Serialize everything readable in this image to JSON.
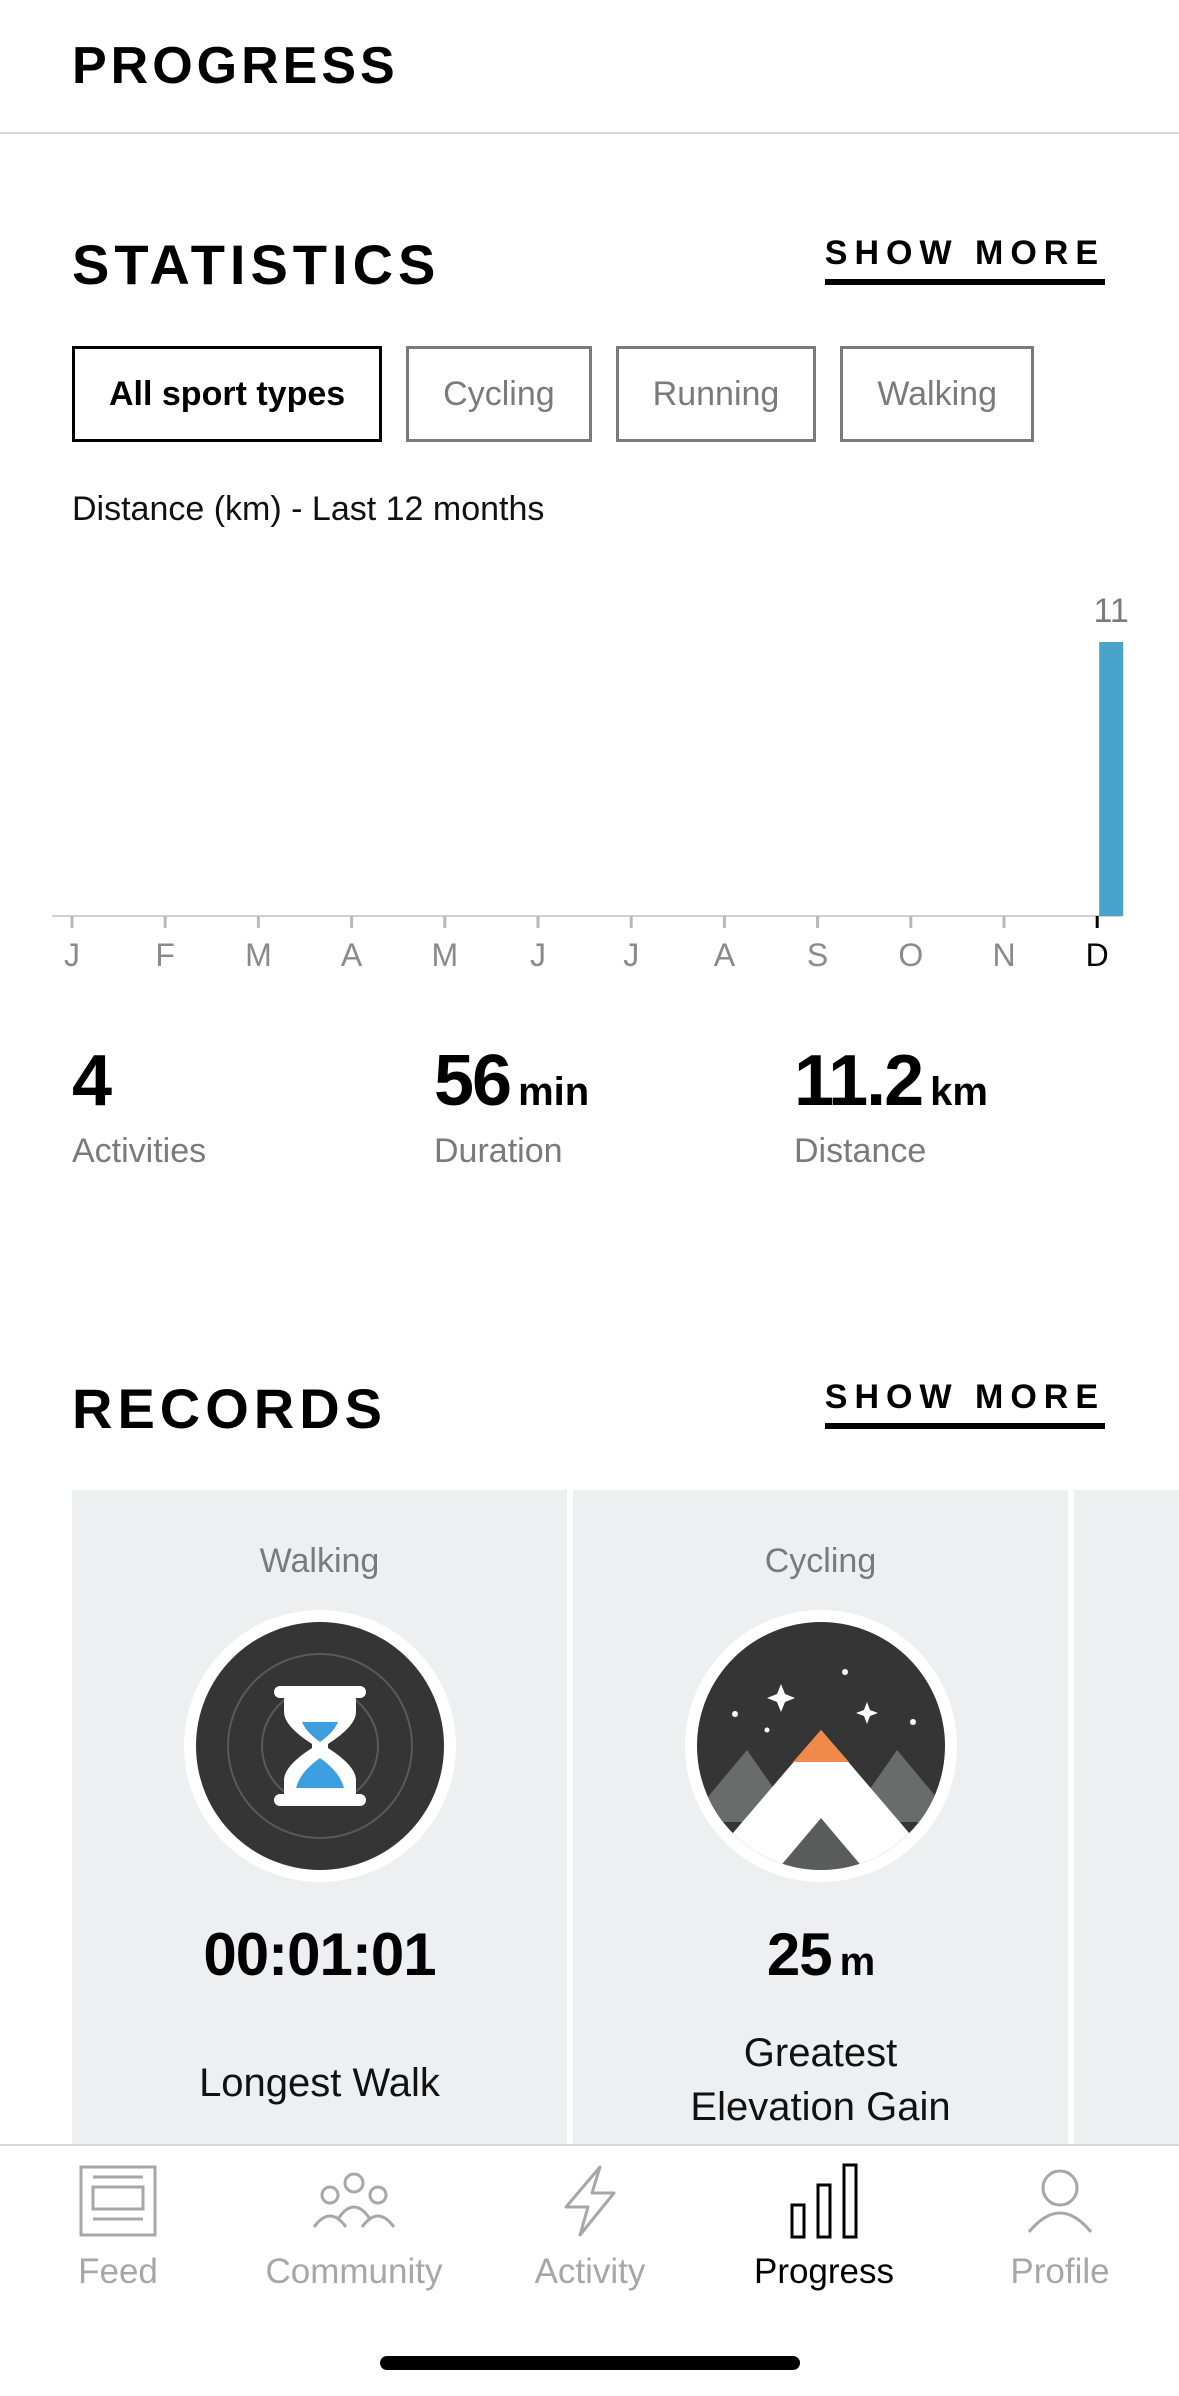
{
  "header": {
    "title": "PROGRESS"
  },
  "statistics": {
    "title": "STATISTICS",
    "show_more": "SHOW MORE",
    "filters": [
      "All sport types",
      "Cycling",
      "Running",
      "Walking"
    ],
    "active_filter": "All sport types",
    "chart_label": "Distance (km) - Last 12 months",
    "stats": [
      {
        "value": "4",
        "unit": "",
        "label": "Activities"
      },
      {
        "value": "56",
        "unit": "min",
        "label": "Duration"
      },
      {
        "value": "11.2",
        "unit": "km",
        "label": "Distance"
      }
    ]
  },
  "chart_data": {
    "type": "bar",
    "categories": [
      "J",
      "F",
      "M",
      "A",
      "M",
      "J",
      "J",
      "A",
      "S",
      "O",
      "N",
      "D"
    ],
    "values": [
      0,
      0,
      0,
      0,
      0,
      0,
      0,
      0,
      0,
      0,
      0,
      11
    ],
    "data_labels": [
      "",
      "",
      "",
      "",
      "",
      "",
      "",
      "",
      "",
      "",
      "",
      "11"
    ],
    "bar_color": "#4aa3cb",
    "ylim": [
      0,
      11
    ],
    "grid": false
  },
  "records": {
    "title": "RECORDS",
    "show_more": "SHOW MORE",
    "cards": [
      {
        "sport": "Walking",
        "value": "00:01:01",
        "unit": "",
        "name": "Longest Walk",
        "icon": "hourglass-badge-icon"
      },
      {
        "sport": "Cycling",
        "value": "25",
        "unit": "m",
        "name_line1": "Greatest",
        "name_line2": "Elevation Gain",
        "icon": "mountain-badge-icon"
      }
    ]
  },
  "tabbar": {
    "tabs": [
      {
        "label": "Feed",
        "icon": "feed-icon"
      },
      {
        "label": "Community",
        "icon": "community-icon"
      },
      {
        "label": "Activity",
        "icon": "lightning-icon"
      },
      {
        "label": "Progress",
        "icon": "bar-chart-icon"
      },
      {
        "label": "Profile",
        "icon": "person-icon"
      }
    ],
    "active": "Progress"
  },
  "colors": {
    "accent_blue": "#4aa3cb",
    "badge_dark": "#353535",
    "badge_orange": "#f08a4b",
    "card_bg": "#eeeff0",
    "inactive_gray": "#a7a7a7"
  }
}
